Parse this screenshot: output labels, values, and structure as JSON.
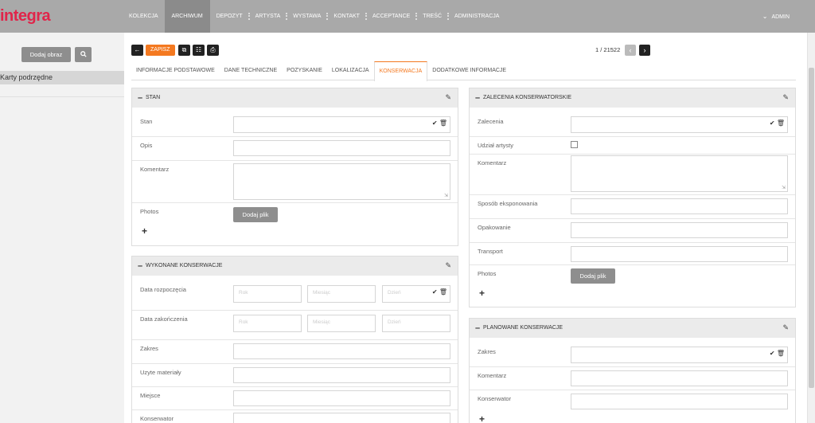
{
  "app": {
    "logo": "integra"
  },
  "nav": {
    "items": [
      "KOLEKCJA",
      "ARCHIWUM",
      "DEPOZYT",
      "ARTYSTA",
      "WYSTAWA",
      "KONTAKT",
      "ACCEPTANCE",
      "TREŚĆ",
      "ADMINISTRACJA"
    ],
    "active": "ARCHIWUM",
    "user": "ADMIN"
  },
  "sidebar": {
    "add_image_label": "Dodaj obraz",
    "search_icon": "search-icon",
    "item_label": "Karty podrzędne"
  },
  "toolbar": {
    "save_label": "ZAPISZ",
    "pager_text": "1 / 21522"
  },
  "tabs": [
    "INFORMACJE PODSTAWOWE",
    "DANE TECHNICZNE",
    "POZYSKANIE",
    "LOKALIZACJA",
    "KONSERWACJA",
    "DODATKOWE INFORMACJE"
  ],
  "active_tab": "KONSERWACJA",
  "stan": {
    "title": "STAN",
    "stan_label": "Stan",
    "opis_label": "Opis",
    "komentarz_label": "Komentarz",
    "photos_label": "Photos",
    "add_file_label": "Dodaj plik"
  },
  "wykonane": {
    "title": "WYKONANE KONSERWACJE",
    "start_label": "Data rozpoczęcia",
    "end_label": "Data zakończenia",
    "zakres_label": "Zakres",
    "materials_label": "Uzyte materiały",
    "miejsce_label": "Miejsce",
    "konserwator_label": "Konserwator",
    "year_placeholder": "Rok",
    "month_placeholder": "Miesiąc",
    "day_placeholder": "Dzień"
  },
  "zalecenia": {
    "title": "ZALECENIA KONSERWATORSKIE",
    "zalecenia_label": "Zalecenia",
    "artist_label": "Udział artysty",
    "komentarz_label": "Komentarz",
    "exhibit_label": "Sposób eksponowania",
    "packaging_label": "Opakowanie",
    "transport_label": "Transport",
    "photos_label": "Photos",
    "add_file_label": "Dodaj plik"
  },
  "planowane": {
    "title": "PLANOWANE KONSERWACJE",
    "zakres_label": "Zakres",
    "komentarz_label": "Komentarz",
    "konserwator_label": "Konserwator"
  }
}
